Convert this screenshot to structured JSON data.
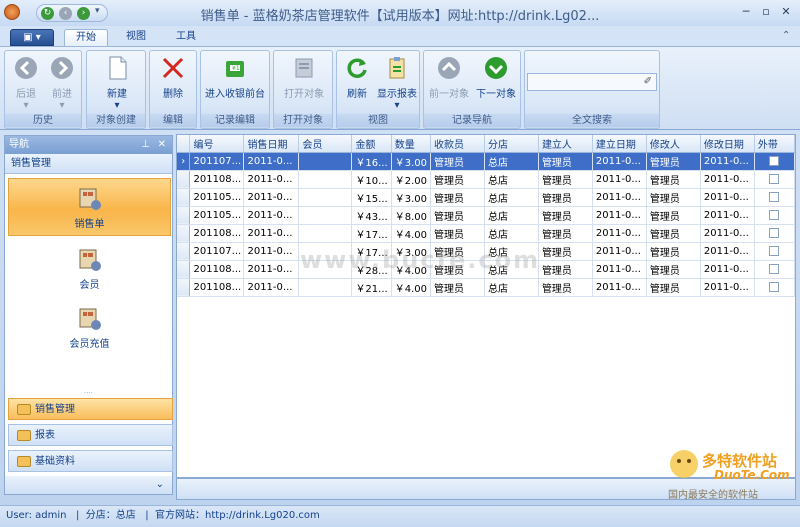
{
  "window": {
    "title": "销售单 - 蓝格奶茶店管理软件【试用版本】网址:http://drink.Lg02..."
  },
  "tabs": [
    {
      "label": "开始"
    },
    {
      "label": "视图"
    },
    {
      "label": "工具"
    }
  ],
  "ribbon": {
    "groups": [
      {
        "label": "历史",
        "buttons": [
          {
            "label": "后退"
          },
          {
            "label": "前进"
          }
        ]
      },
      {
        "label": "对象创建",
        "buttons": [
          {
            "label": "新建"
          }
        ]
      },
      {
        "label": "编辑",
        "buttons": [
          {
            "label": "删除"
          }
        ]
      },
      {
        "label": "记录编辑",
        "buttons": [
          {
            "label": "进入收银前台"
          }
        ]
      },
      {
        "label": "打开对象",
        "buttons": [
          {
            "label": "打开对象"
          }
        ]
      },
      {
        "label": "视图",
        "buttons": [
          {
            "label": "刷新"
          },
          {
            "label": "显示报表"
          }
        ]
      },
      {
        "label": "记录导航",
        "buttons": [
          {
            "label": "前一对象"
          },
          {
            "label": "下一对象"
          }
        ]
      },
      {
        "label": "全文搜索"
      }
    ]
  },
  "nav": {
    "header": "导航",
    "section": "销售管理",
    "items": [
      {
        "label": "销售单"
      },
      {
        "label": "会员"
      },
      {
        "label": "会员充值"
      }
    ],
    "groups": [
      {
        "label": "销售管理"
      },
      {
        "label": "报表"
      },
      {
        "label": "基础资料"
      }
    ]
  },
  "grid": {
    "columns": [
      "编号",
      "销售日期",
      "会员",
      "金额",
      "数量",
      "收款员",
      "分店",
      "建立人",
      "建立日期",
      "修改人",
      "修改日期",
      "外带"
    ],
    "rows": [
      [
        "201107...",
        "2011-0...",
        "",
        "￥16...",
        "￥3.00",
        "管理员",
        "总店",
        "管理员",
        "2011-0...",
        "管理员",
        "2011-0..."
      ],
      [
        "201108...",
        "2011-0...",
        "",
        "￥10...",
        "￥2.00",
        "管理员",
        "总店",
        "管理员",
        "2011-0...",
        "管理员",
        "2011-0..."
      ],
      [
        "201105...",
        "2011-0...",
        "",
        "￥15...",
        "￥3.00",
        "管理员",
        "总店",
        "管理员",
        "2011-0...",
        "管理员",
        "2011-0..."
      ],
      [
        "201105...",
        "2011-0...",
        "",
        "￥43...",
        "￥8.00",
        "管理员",
        "总店",
        "管理员",
        "2011-0...",
        "管理员",
        "2011-0..."
      ],
      [
        "201108...",
        "2011-0...",
        "",
        "￥17...",
        "￥4.00",
        "管理员",
        "总店",
        "管理员",
        "2011-0...",
        "管理员",
        "2011-0..."
      ],
      [
        "201107...",
        "2011-0...",
        "",
        "￥17...",
        "￥3.00",
        "管理员",
        "总店",
        "管理员",
        "2011-0...",
        "管理员",
        "2011-0..."
      ],
      [
        "201108...",
        "2011-0...",
        "",
        "￥28...",
        "￥4.00",
        "管理员",
        "总店",
        "管理员",
        "2011-0...",
        "管理员",
        "2011-0..."
      ],
      [
        "201108...",
        "2011-0...",
        "",
        "￥21...",
        "￥4.00",
        "管理员",
        "总店",
        "管理员",
        "2011-0...",
        "管理员",
        "2011-0..."
      ]
    ]
  },
  "status": {
    "text": "User: admin   |  分店：总店   |  官方网站：http://drink.Lg020.com"
  },
  "watermark": {
    "text": "www.bucfe.com"
  },
  "logo": {
    "title": "多特软件站",
    "domain": "DuoTe.Com",
    "tagline": "国内最安全的软件站"
  }
}
